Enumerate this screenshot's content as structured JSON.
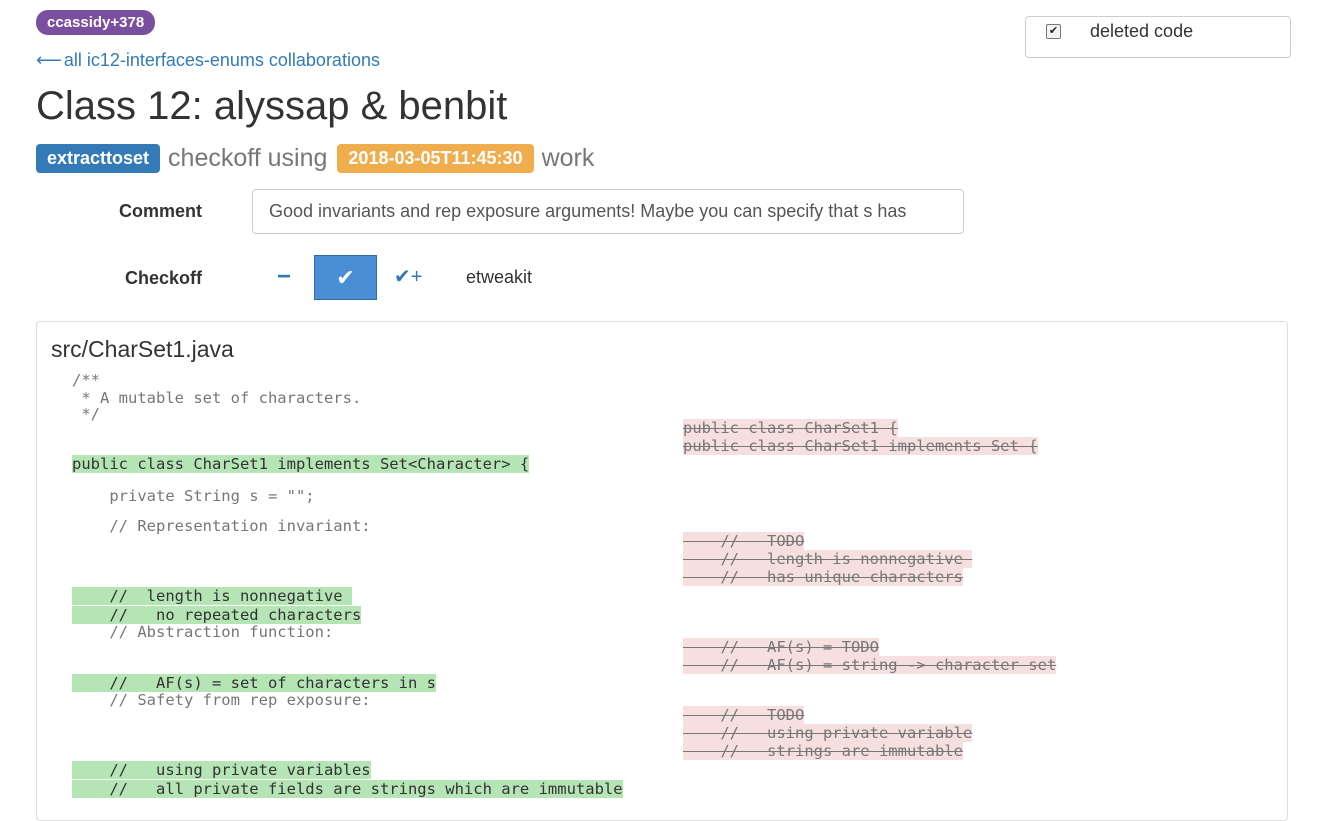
{
  "header": {
    "user_badge": "ccassidy+378",
    "back_link": "all ic12-interfaces-enums collaborations",
    "back_arrow": "⟵",
    "title": "Class 12: alyssap & benbit",
    "subtitle": {
      "tag": "extracttoset",
      "text_mid": "checkoff using",
      "timestamp": "2018-03-05T11:45:30",
      "text_end": "work"
    }
  },
  "deleted_code": {
    "label": "deleted code",
    "checked": true
  },
  "form": {
    "comment_label": "Comment",
    "comment_value": "Good invariants and rep exposure arguments! Maybe you can specify that s has",
    "checkoff_label": "Checkoff",
    "checkoff_minus": "−",
    "checkoff_check": "✔",
    "checkoff_checkplus": "✔+",
    "checker": "etweakit"
  },
  "file": {
    "path": "src/CharSet1.java",
    "lines": {
      "doc_open": "/**",
      "doc_body": " * A mutable set of characters.",
      "doc_close": " */",
      "del_class_1": "public class CharSet1 {",
      "del_class_2": "public class CharSet1 implements Set {",
      "ins_class": "public class CharSet1 implements Set<Character> {",
      "field": "    private String s = \"\";",
      "rep_inv": "    // Representation invariant:",
      "del_ri_1": "    //   TODO",
      "del_ri_2": "    //   length is nonnegative ",
      "del_ri_3": "    //   has unique characters",
      "ins_ri_1": "    //  length is nonnegative ",
      "ins_ri_2": "    //   no repeated characters",
      "abs_fn": "    // Abstraction function:",
      "del_af_1": "    //   AF(s) = TODO",
      "del_af_2": "    //   AF(s) = string -> character set",
      "ins_af": "    //   AF(s) = set of characters in s",
      "safety": "    // Safety from rep exposure:",
      "del_sf_1": "    //   TODO",
      "del_sf_2": "    //   using private variable",
      "del_sf_3": "    //   strings are immutable",
      "ins_sf_1": "    //   using private variables",
      "ins_sf_2": "    //   all private fields are strings which are immutable"
    }
  }
}
